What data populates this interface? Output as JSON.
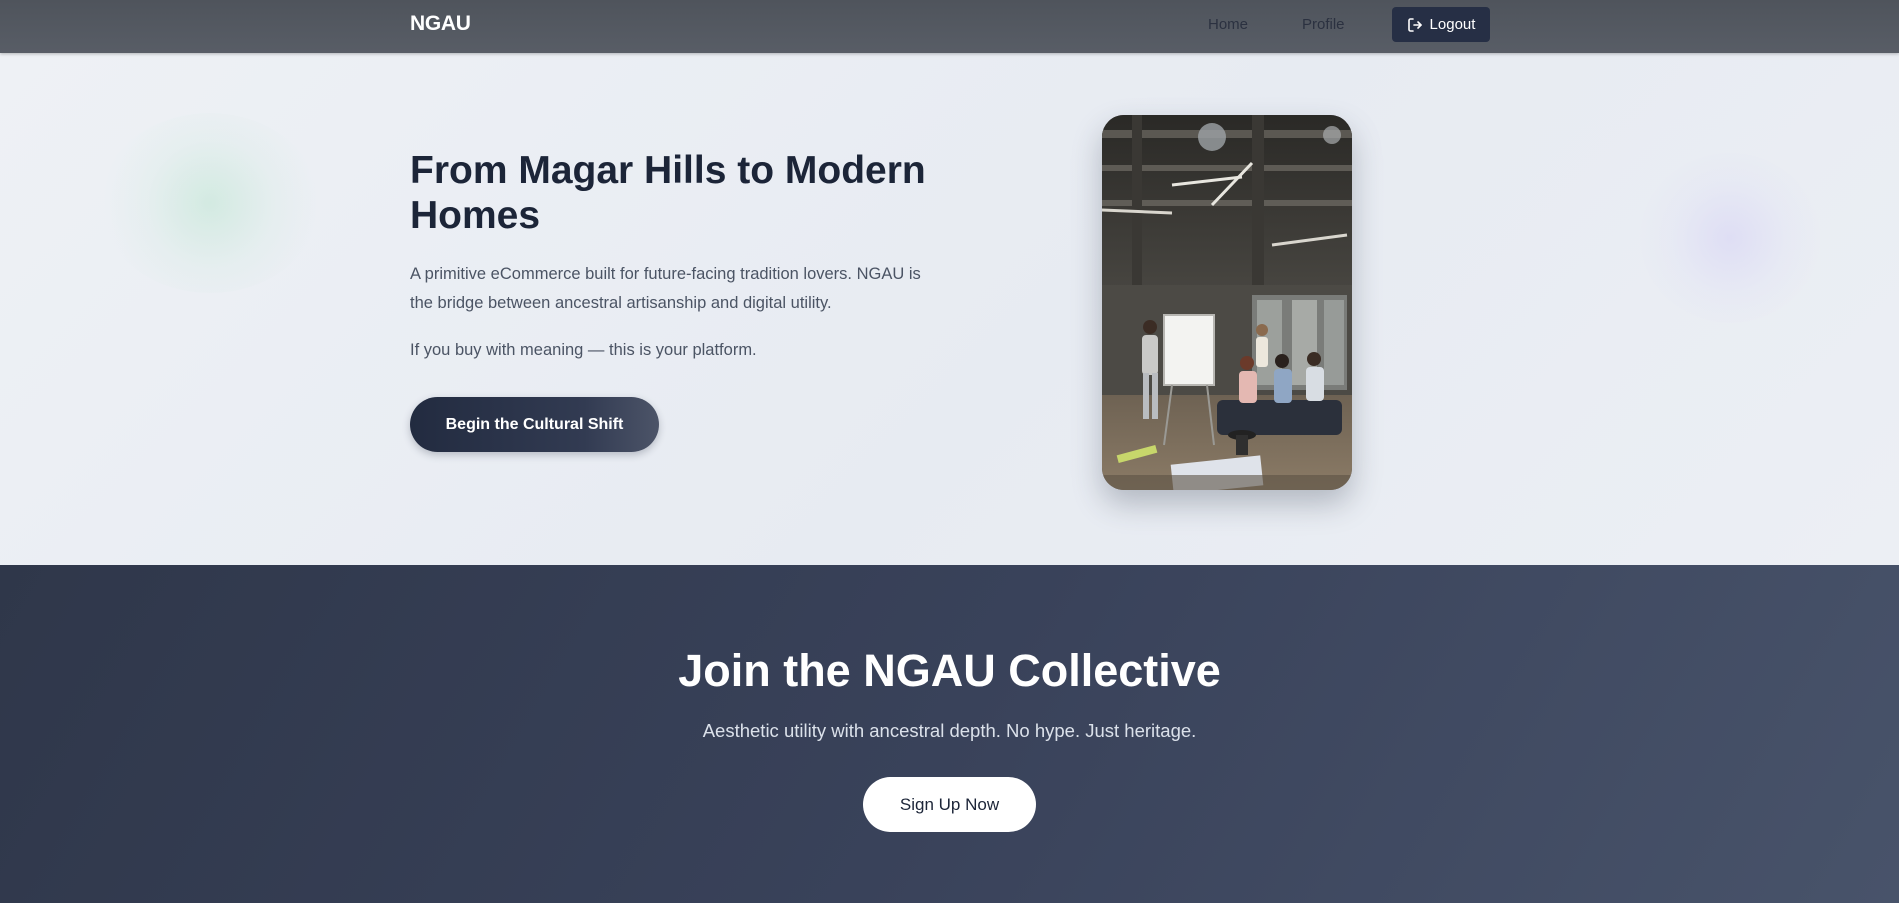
{
  "navbar": {
    "brand": "NGAU",
    "links": [
      {
        "label": "Home"
      },
      {
        "label": "Profile"
      }
    ],
    "logout_label": "Logout",
    "logout_icon": "logout-icon"
  },
  "hero": {
    "title": "From Magar Hills to Modern Homes",
    "description": "A primitive eCommerce built for future-facing tradition lovers. NGAU is the bridge between ancestral artisanship and digital utility.",
    "tagline": "If you buy with meaning — this is your platform.",
    "cta_label": "Begin the Cultural Shift",
    "image": "team-meeting-office-photo"
  },
  "collective": {
    "title": "Join the NGAU Collective",
    "subtitle": "Aesthetic utility with ancestral depth. No hype. Just heritage.",
    "signup_label": "Sign Up Now"
  },
  "colors": {
    "navbar": "#54595f",
    "primary_dark": "#262f45",
    "hero_text": "#1c2538",
    "body_text": "#4b5464",
    "collective_bg": "#39425a"
  }
}
